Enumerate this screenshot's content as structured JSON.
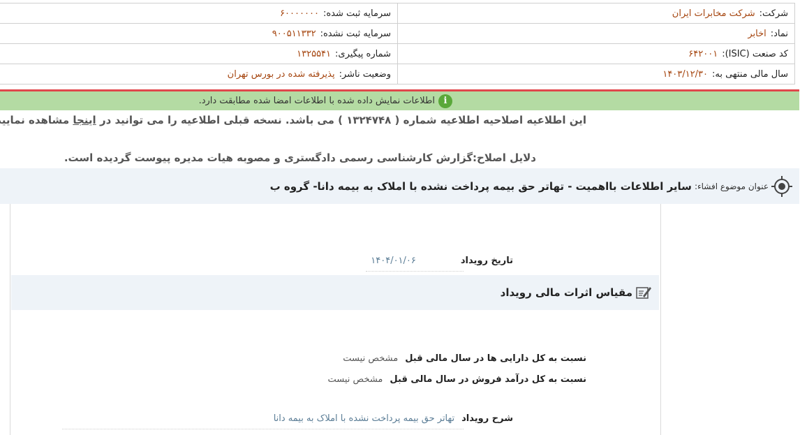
{
  "company_info": {
    "rows": [
      [
        {
          "label": "شرکت:",
          "value": "شرکت مخابرات ایران"
        },
        {
          "label": "سرمایه ثبت شده:",
          "value": "۶۰۰۰۰۰۰۰"
        }
      ],
      [
        {
          "label": "نماد:",
          "value": "اخابر"
        },
        {
          "label": "سرمایه ثبت نشده:",
          "value": "۹۰۰۵۱۱۳۳۲"
        }
      ],
      [
        {
          "label": "کد صنعت (ISIC):",
          "value": "۶۴۲۰۰۱"
        },
        {
          "label": "شماره پیگیری:",
          "value": "۱۳۲۵۵۴۱"
        }
      ],
      [
        {
          "label": "سال مالی منتهی به:",
          "value": "۱۴۰۳/۱۲/۳۰"
        },
        {
          "label": "وضعیت ناشر:",
          "value": "پذیرفته شده در بورس تهران"
        }
      ]
    ]
  },
  "notice": {
    "text": "اطلاعات نمایش داده شده با اطلاعات امضا شده مطابقت دارد.",
    "icon": "info-icon"
  },
  "correction": {
    "text_before": "این اطلاعیه اصلاحیه اطلاعیه شماره ( ۱۳۲۴۷۴۸ ) می باشد. نسخه قبلی اطلاعیه را می توانید در",
    "link": "اینجا",
    "text_after": "مشاهده نمایید"
  },
  "reasons": "دلایل اصلاح:گزارش کارشناسی رسمی دادگستری و مصوبه هیات مدیره پیوست گردیده است.",
  "subject": {
    "label": "عنوان موضوع افشاء:",
    "value": "سایر اطلاعات بااهمیت - تهاتر حق بیمه پرداخت نشده با املاک به بیمه دانا- گروه ب",
    "icon": "target-icon"
  },
  "event_date": {
    "label": "تاریخ رویداد",
    "value": "۱۴۰۴/۰۱/۰۶"
  },
  "section": {
    "title": "مقیاس اثرات مالی رویداد",
    "icon": "pencil-icon"
  },
  "ratios": [
    {
      "label": "نسبت به کل دارایی ها در سال مالی قبل",
      "value": "مشخص نیست"
    },
    {
      "label": "نسبت به کل درآمد فروش در سال مالی قبل",
      "value": "مشخص نیست"
    }
  ],
  "event_description": {
    "label": "شرح رویداد",
    "value": "تهاتر حق بیمه پرداخت نشده با املاک به بیمه دانا"
  },
  "colors": {
    "value_text": "#a5450f",
    "notice_bg": "#b4dba3",
    "accent_red": "#e0474c",
    "section_bg": "#eef3f8"
  }
}
